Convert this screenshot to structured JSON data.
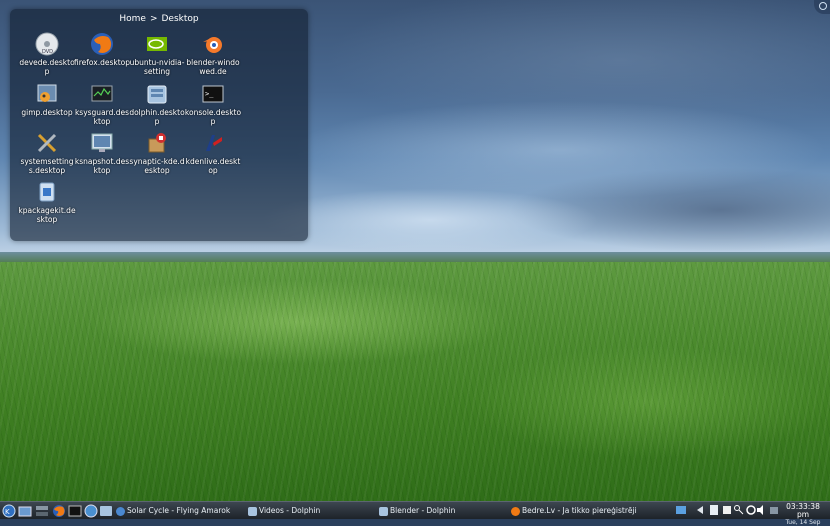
{
  "folderview": {
    "breadcrumb": [
      "Home",
      ">",
      "Desktop"
    ],
    "icons": [
      {
        "label": "devede.desktop",
        "icon": "dvd-disc-icon"
      },
      {
        "label": "firefox.desktop",
        "icon": "firefox-icon"
      },
      {
        "label": "ubuntu-nvidia-setting",
        "icon": "nvidia-icon"
      },
      {
        "label": "blender-windowed.de",
        "icon": "blender-icon"
      },
      {
        "label": "gimp.desktop",
        "icon": "gimp-icon"
      },
      {
        "label": "ksysguard.desktop",
        "icon": "system-monitor-icon"
      },
      {
        "label": "dolphin.desktop",
        "icon": "file-manager-icon"
      },
      {
        "label": "konsole.desktop",
        "icon": "terminal-icon"
      },
      {
        "label": "systemsettings.desktop",
        "icon": "tools-icon"
      },
      {
        "label": "ksnapshot.desktop",
        "icon": "screenshot-icon"
      },
      {
        "label": "synaptic-kde.desktop",
        "icon": "package-manager-icon"
      },
      {
        "label": "kdenlive.desktop",
        "icon": "video-editor-icon"
      },
      {
        "label": "kpackagekit.desktop",
        "icon": "package-installer-icon"
      }
    ]
  },
  "taskbar": {
    "tasks": [
      {
        "label": "Solar Cycle - Flying  Amarok",
        "icon": "amarok-icon"
      },
      {
        "label": "Videos - Dolphin",
        "icon": "dolphin-icon"
      },
      {
        "label": "Blender - Dolphin",
        "icon": "dolphin-icon"
      },
      {
        "label": "Bedre.Lv - Ja tikko piereģistrējies, c",
        "icon": "firefox-icon"
      }
    ],
    "clock": {
      "time": "03:33:38 pm",
      "date": "Tue, 14 Sep"
    }
  },
  "colors": {
    "panel": "#2b333b",
    "widget": "#121e30",
    "grass": "#4d8c2f",
    "sky": "#4a6a92"
  }
}
